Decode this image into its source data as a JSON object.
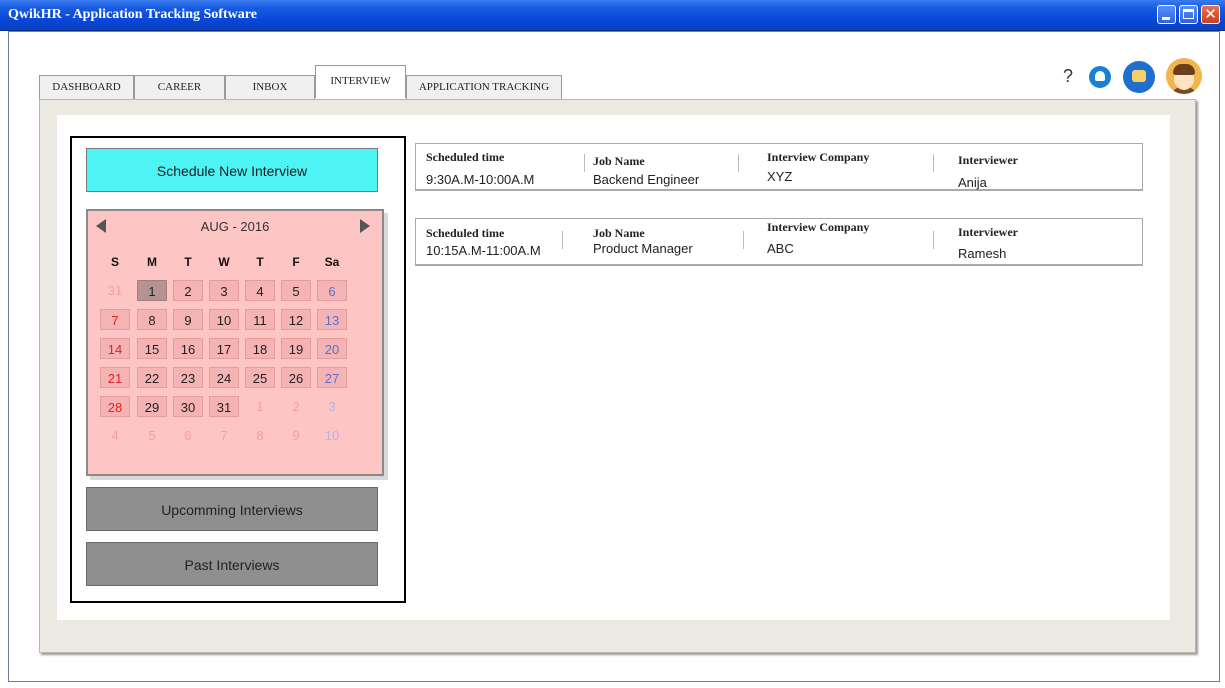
{
  "app": {
    "title": "QwikHR - Application Tracking Software"
  },
  "tabs": [
    {
      "label": "DASHBOARD"
    },
    {
      "label": "CAREER"
    },
    {
      "label": "INBOX"
    },
    {
      "label": "INTERVIEW"
    },
    {
      "label": "APPLICATION TRACKING"
    }
  ],
  "active_tab": "INTERVIEW",
  "header_icons": {
    "help": "?",
    "icons": [
      "bell-icon",
      "chat-icon",
      "avatar"
    ]
  },
  "sidebar": {
    "schedule_label": "Schedule New Interview",
    "upcoming_label": "Upcomming Interviews",
    "past_label": "Past Interviews"
  },
  "calendar": {
    "month": "AUG - 2016",
    "weekdays": [
      "S",
      "M",
      "T",
      "W",
      "T",
      "F",
      "Sa"
    ],
    "selected_day": "1",
    "weeks": [
      [
        "31",
        "1",
        "2",
        "3",
        "4",
        "5",
        "6"
      ],
      [
        "7",
        "8",
        "9",
        "10",
        "11",
        "12",
        "13"
      ],
      [
        "14",
        "15",
        "16",
        "17",
        "18",
        "19",
        "20"
      ],
      [
        "21",
        "22",
        "23",
        "24",
        "25",
        "26",
        "27"
      ],
      [
        "28",
        "29",
        "30",
        "31",
        "1",
        "2",
        "3"
      ],
      [
        "4",
        "5",
        "6",
        "7",
        "8",
        "9",
        "10"
      ]
    ]
  },
  "interviews": [
    {
      "time_label": "Scheduled time",
      "time": "9:30A.M-10:00A.M",
      "job_label": "Job Name",
      "job": "Backend Engineer",
      "company_label": "Interview Company",
      "company": "XYZ",
      "interviewer_label": "Interviewer",
      "interviewer": "Anija"
    },
    {
      "time_label": "Scheduled time",
      "time": "10:15A.M-11:00A.M",
      "job_label": "Job Name",
      "job": "Product Manager",
      "company_label": "Interview Company",
      "company": "ABC",
      "interviewer_label": "Interviewer",
      "interviewer": "Ramesh"
    }
  ]
}
